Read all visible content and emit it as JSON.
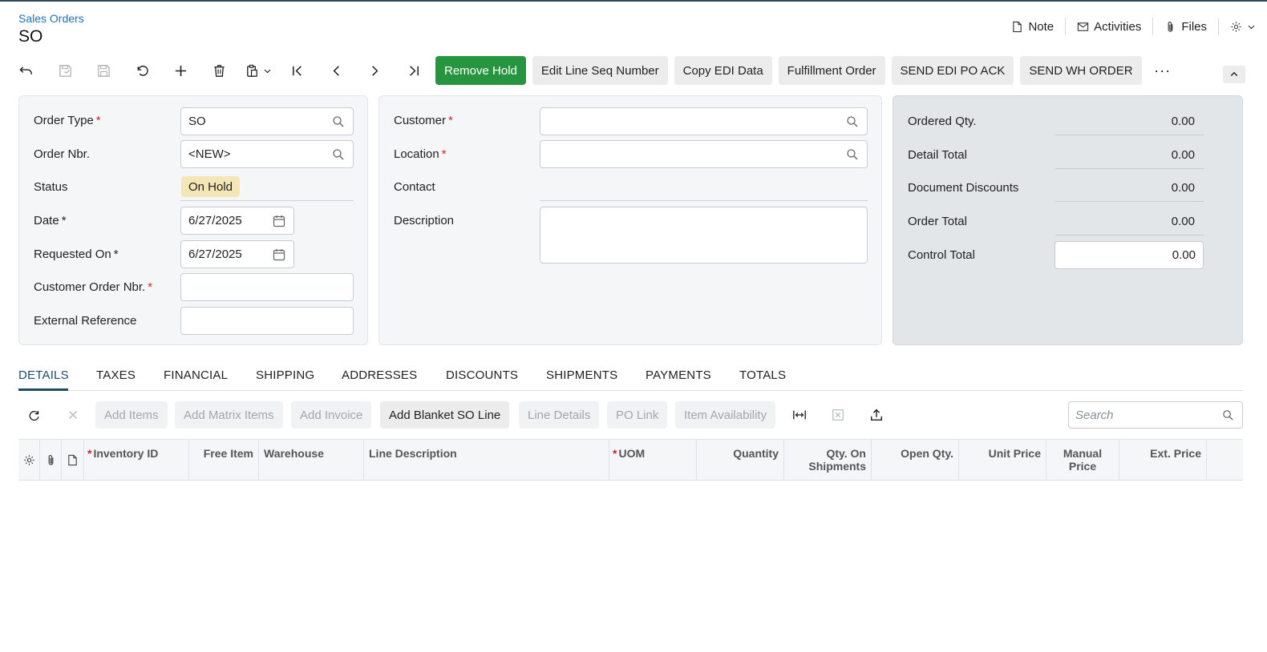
{
  "header": {
    "breadcrumb": "Sales Orders",
    "title": "SO",
    "links": [
      {
        "label": "Note",
        "icon": "note-icon"
      },
      {
        "label": "Activities",
        "icon": "mail-icon"
      },
      {
        "label": "Files",
        "icon": "paperclip-icon"
      }
    ],
    "settings_icon": "gear-icon"
  },
  "toolbar": {
    "icons": [
      "undo-icon",
      "save-close-icon",
      "save-icon",
      "cancel-icon",
      "add-icon",
      "delete-icon",
      "copy-paste-icon",
      "first-icon",
      "previous-icon",
      "next-icon",
      "last-icon"
    ],
    "remove_hold": "Remove Hold",
    "edit_line_seq": "Edit Line Seq Number",
    "copy_edi": "Copy EDI Data",
    "fulfillment": "Fulfillment Order",
    "send_edi": "SEND EDI PO ACK",
    "send_wh": "SEND WH ORDER",
    "more": "···"
  },
  "order": {
    "order_type_label": "Order Type",
    "order_type_value": "SO",
    "order_nbr_label": "Order Nbr.",
    "order_nbr_value": "<NEW>",
    "status_label": "Status",
    "status_value": "On Hold",
    "date_label": "Date",
    "date_value": "6/27/2025",
    "requested_on_label": "Requested On",
    "requested_on_value": "6/27/2025",
    "customer_order_nbr_label": "Customer Order Nbr.",
    "customer_order_nbr_value": "",
    "external_ref_label": "External Reference",
    "external_ref_value": ""
  },
  "customer": {
    "customer_label": "Customer",
    "customer_value": "",
    "location_label": "Location",
    "location_value": "",
    "contact_label": "Contact",
    "description_label": "Description",
    "description_value": ""
  },
  "summary": {
    "ordered_qty_label": "Ordered Qty.",
    "ordered_qty_value": "0.00",
    "detail_total_label": "Detail Total",
    "detail_total_value": "0.00",
    "doc_discounts_label": "Document Discounts",
    "doc_discounts_value": "0.00",
    "order_total_label": "Order Total",
    "order_total_value": "0.00",
    "control_total_label": "Control Total",
    "control_total_value": "0.00"
  },
  "tabs": [
    "DETAILS",
    "TAXES",
    "FINANCIAL",
    "SHIPPING",
    "ADDRESSES",
    "DISCOUNTS",
    "SHIPMENTS",
    "PAYMENTS",
    "TOTALS"
  ],
  "grid_toolbar": {
    "add_items": "Add Items",
    "add_matrix": "Add Matrix Items",
    "add_invoice": "Add Invoice",
    "add_blanket": "Add Blanket SO Line",
    "line_details": "Line Details",
    "po_link": "PO Link",
    "item_availability": "Item Availability",
    "search_placeholder": "Search"
  },
  "grid_columns": {
    "inventory_id": "Inventory ID",
    "free_item": "Free Item",
    "warehouse": "Warehouse",
    "line_description": "Line Description",
    "uom": "UOM",
    "quantity": "Quantity",
    "qty_on_shipments": "Qty. On Shipments",
    "open_qty": "Open Qty.",
    "unit_price": "Unit Price",
    "manual_price": "Manual Price",
    "ext_price": "Ext. Price"
  },
  "colors": {
    "primary_button": "#27953f",
    "required": "#d0252b",
    "link": "#1a73b5",
    "status_badge": "#f5e6b7"
  }
}
